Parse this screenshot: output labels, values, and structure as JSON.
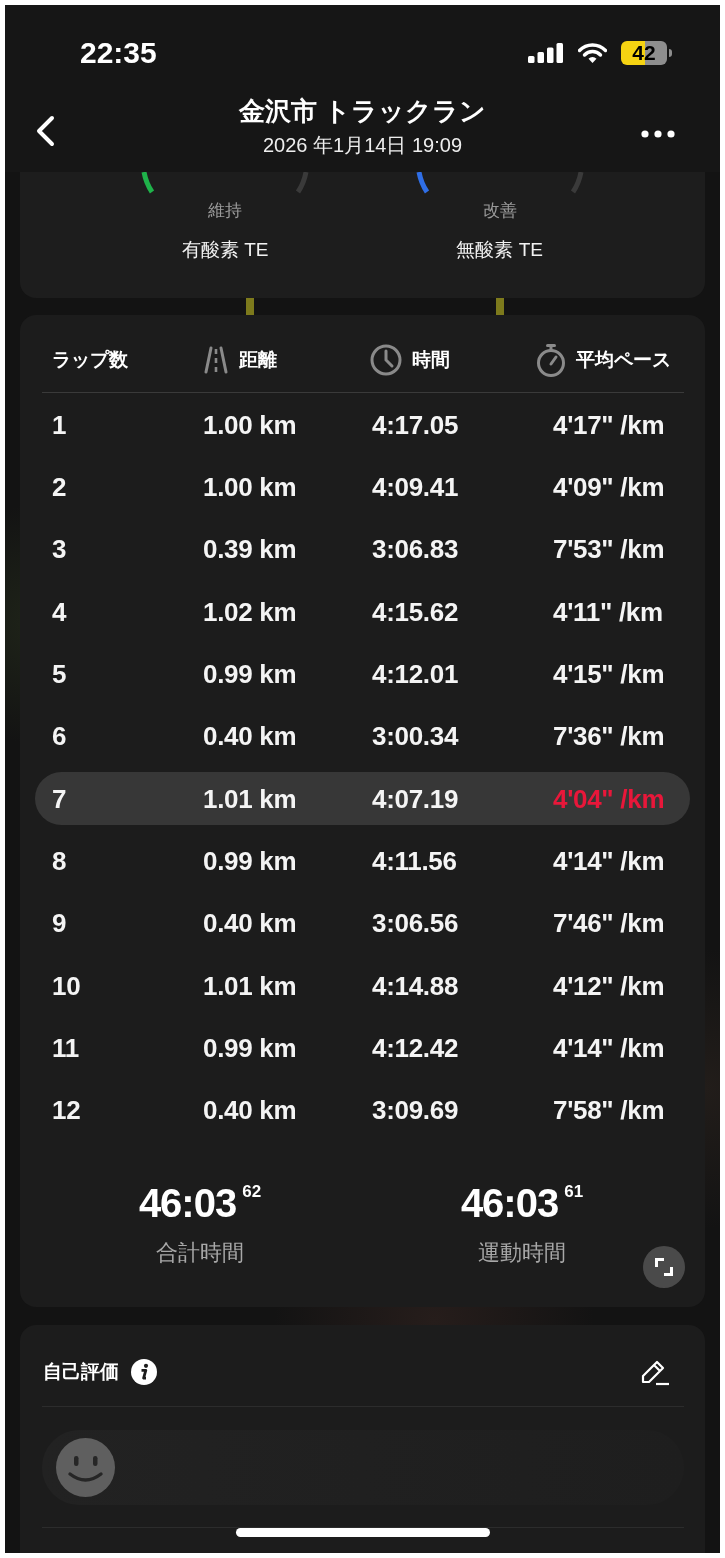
{
  "status_bar": {
    "time": "22:35",
    "battery": "42"
  },
  "header": {
    "title": "金沢市 トラックラン",
    "date": "2026 年1月14日 19:09"
  },
  "training_effect": [
    {
      "rating": "維持",
      "label": "有酸素 TE",
      "color": "#1fb24a"
    },
    {
      "rating": "改善",
      "label": "無酸素 TE",
      "color": "#2f6ee6"
    }
  ],
  "laps": {
    "columns": [
      {
        "label": "ラップ数",
        "kind": "plain"
      },
      {
        "label": "距離",
        "kind": "road"
      },
      {
        "label": "時間",
        "kind": "clock"
      },
      {
        "label": "平均ペース",
        "kind": "stopwatch"
      }
    ],
    "rows": [
      {
        "lap": "1",
        "distance": "1.00 km",
        "time": "4:17.05",
        "pace": "4'17\" /km",
        "highlighted": false
      },
      {
        "lap": "2",
        "distance": "1.00 km",
        "time": "4:09.41",
        "pace": "4'09\" /km",
        "highlighted": false
      },
      {
        "lap": "3",
        "distance": "0.39 km",
        "time": "3:06.83",
        "pace": "7'53\" /km",
        "highlighted": false
      },
      {
        "lap": "4",
        "distance": "1.02 km",
        "time": "4:15.62",
        "pace": "4'11\" /km",
        "highlighted": false
      },
      {
        "lap": "5",
        "distance": "0.99 km",
        "time": "4:12.01",
        "pace": "4'15\" /km",
        "highlighted": false
      },
      {
        "lap": "6",
        "distance": "0.40 km",
        "time": "3:00.34",
        "pace": "7'36\" /km",
        "highlighted": false
      },
      {
        "lap": "7",
        "distance": "1.01 km",
        "time": "4:07.19",
        "pace": "4'04\" /km",
        "highlighted": true
      },
      {
        "lap": "8",
        "distance": "0.99 km",
        "time": "4:11.56",
        "pace": "4'14\" /km",
        "highlighted": false
      },
      {
        "lap": "9",
        "distance": "0.40 km",
        "time": "3:06.56",
        "pace": "7'46\" /km",
        "highlighted": false
      },
      {
        "lap": "10",
        "distance": "1.01 km",
        "time": "4:14.88",
        "pace": "4'12\" /km",
        "highlighted": false
      },
      {
        "lap": "11",
        "distance": "0.99 km",
        "time": "4:12.42",
        "pace": "4'14\" /km",
        "highlighted": false
      },
      {
        "lap": "12",
        "distance": "0.40 km",
        "time": "3:09.69",
        "pace": "7'58\" /km",
        "highlighted": false
      }
    ],
    "totals": [
      {
        "time": "46:03$^{62}$",
        "label": "合計時間"
      },
      {
        "time": "46:03$^{61}$",
        "label": "運動時間"
      }
    ]
  },
  "self_evaluation": {
    "title": "自己評価"
  }
}
